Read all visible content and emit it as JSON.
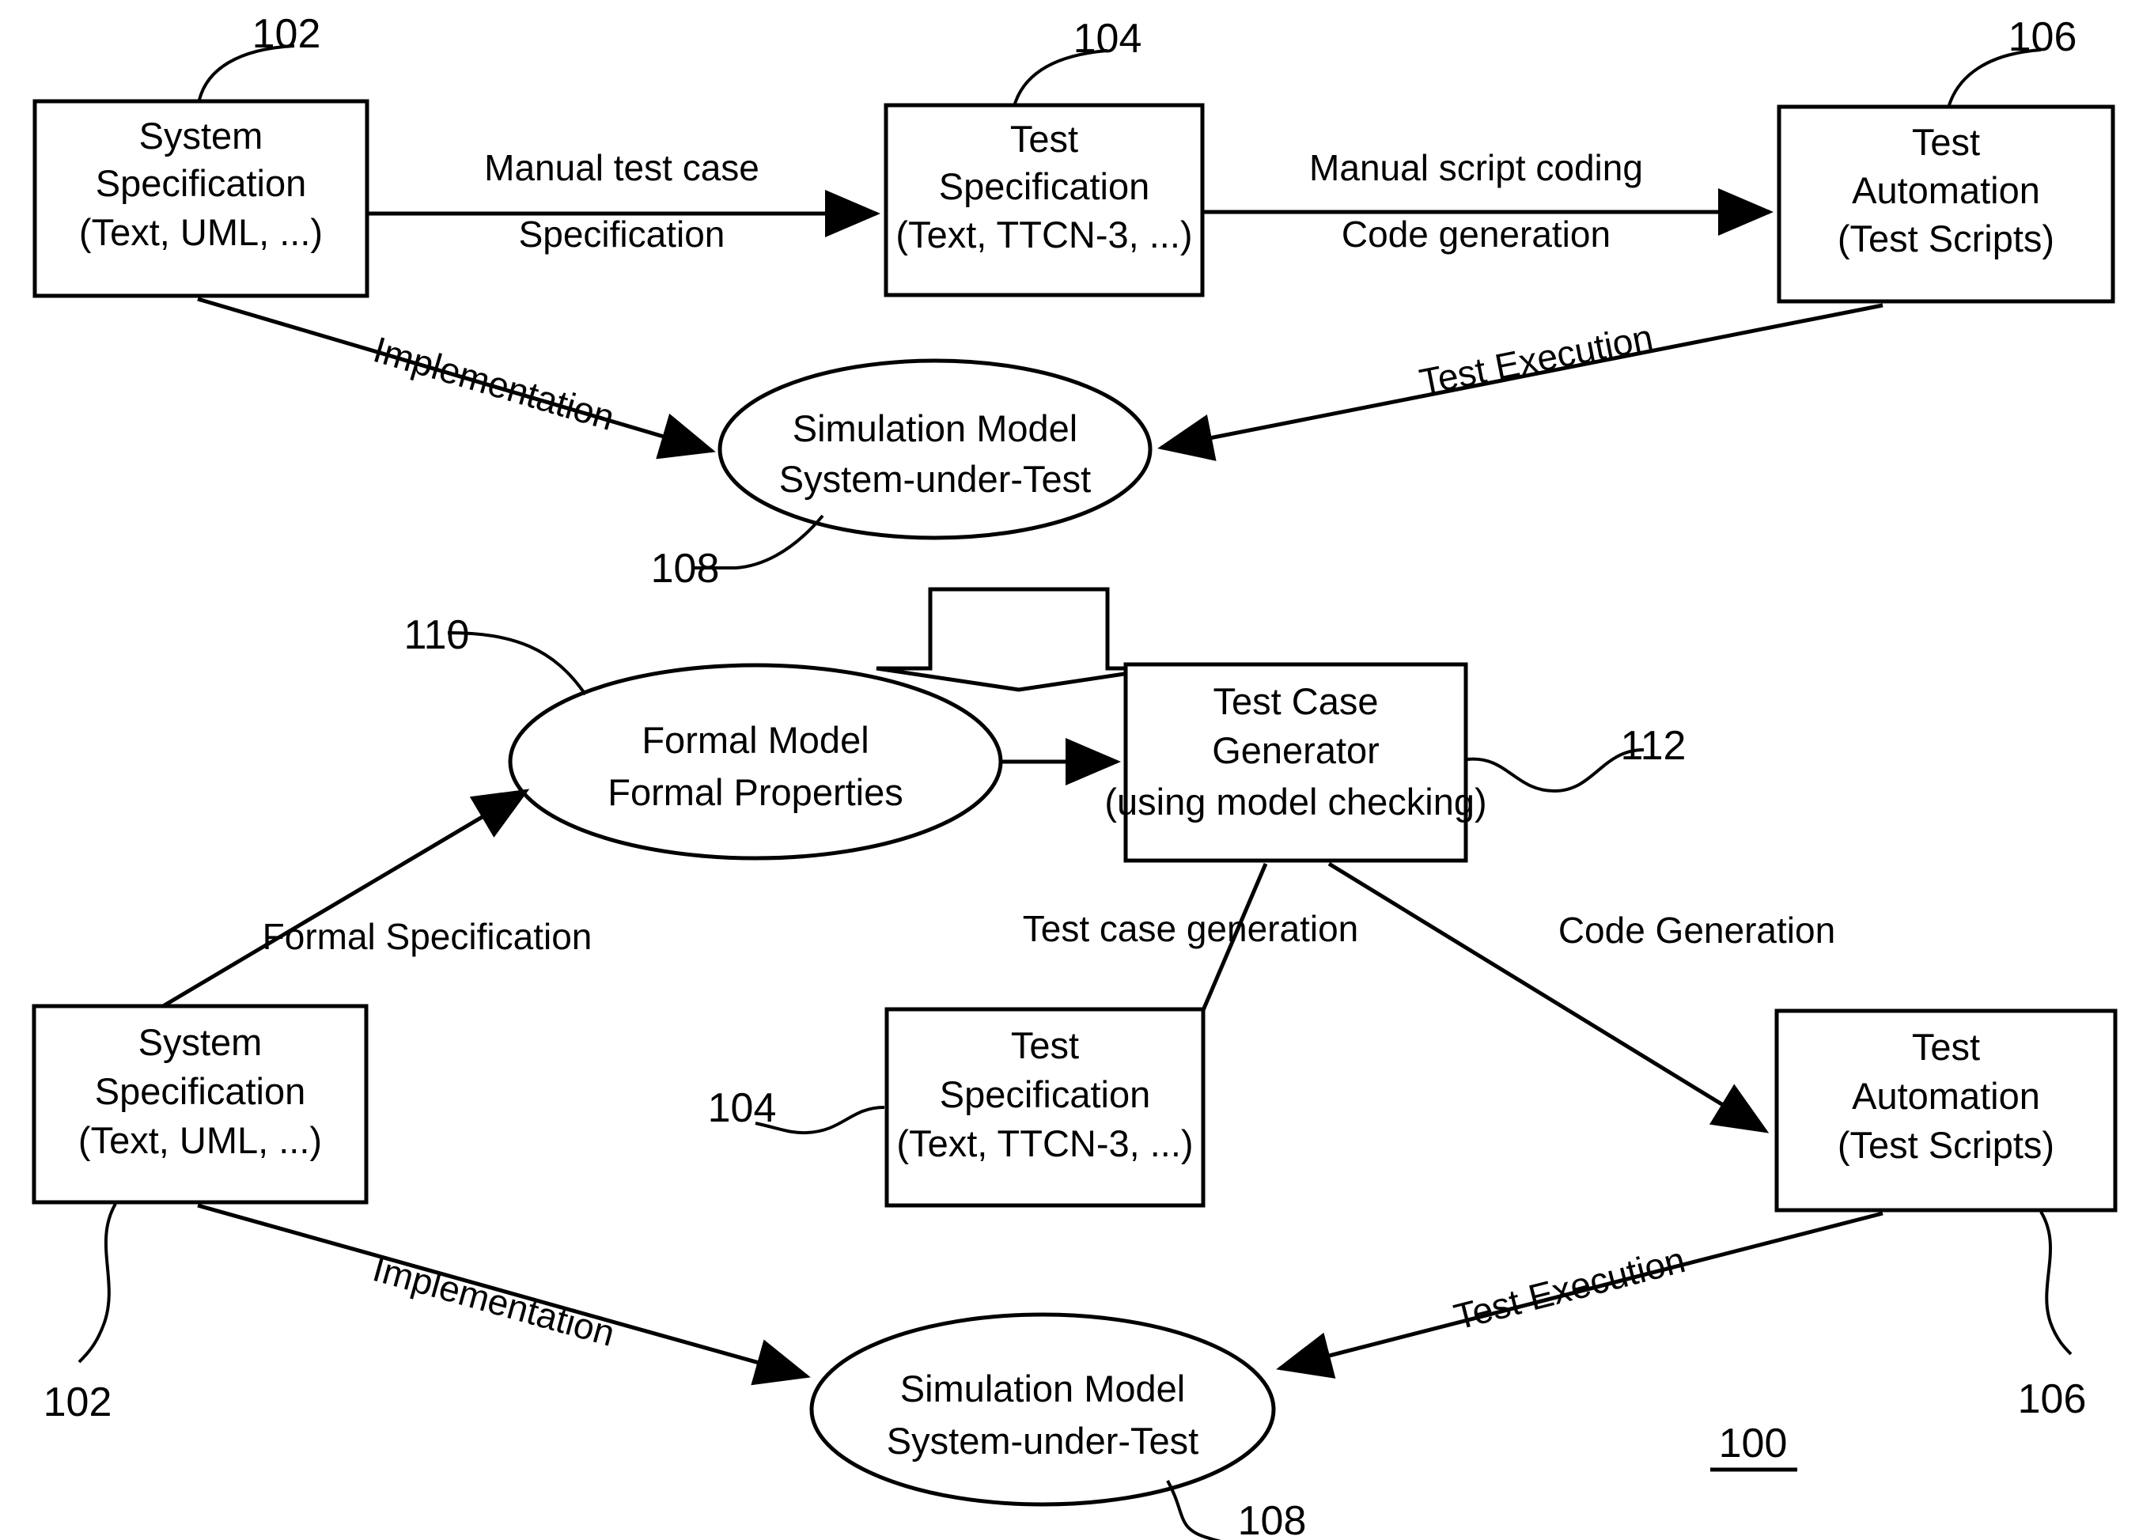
{
  "figure": {
    "number": "100",
    "top_flow_title": "",
    "bottom_flow_title": ""
  },
  "nodes": {
    "sys_spec_top": {
      "ref": "102",
      "line1": "System",
      "line2": "Specification",
      "line3": "(Text, UML, ...)"
    },
    "test_spec_top": {
      "ref": "104",
      "line1": "Test",
      "line2": "Specification",
      "line3": "(Text, TTCN-3, ...)"
    },
    "test_auto_top": {
      "ref": "106",
      "line1": "Test",
      "line2": "Automation",
      "line3": "(Test Scripts)"
    },
    "sim_model_top": {
      "ref": "108",
      "line1": "Simulation Model",
      "line2": "System-under-Test"
    },
    "formal_model": {
      "ref": "110",
      "line1": "Formal Model",
      "line2": "Formal Properties"
    },
    "test_case_gen": {
      "ref": "112",
      "line1": "Test Case",
      "line2": "Generator",
      "line3": "(using model checking)"
    },
    "sys_spec_bottom": {
      "ref": "102",
      "line1": "System",
      "line2": "Specification",
      "line3": "(Text, UML, ...)"
    },
    "test_spec_bottom": {
      "ref": "104",
      "line1": "Test",
      "line2": "Specification",
      "line3": "(Text, TTCN-3, ...)"
    },
    "test_auto_bottom": {
      "ref": "106",
      "line1": "Test",
      "line2": "Automation",
      "line3": "(Test Scripts)"
    },
    "sim_model_bottom": {
      "ref": "108",
      "line1": "Simulation Model",
      "line2": "System-under-Test"
    }
  },
  "edges": {
    "manual_test_case_line1": "Manual test case",
    "manual_test_case_line2": "Specification",
    "manual_script_line1": "Manual script coding",
    "manual_script_line2": "Code generation",
    "implementation_top": "Implementation",
    "test_execution_top": "Test Execution",
    "formal_specification": "Formal Specification",
    "test_case_generation": "Test case generation",
    "code_generation": "Code Generation",
    "implementation_bottom": "Implementation",
    "test_execution_bottom": "Test Execution"
  },
  "colors": {
    "ink": "#000000",
    "paper": "#ffffff"
  }
}
